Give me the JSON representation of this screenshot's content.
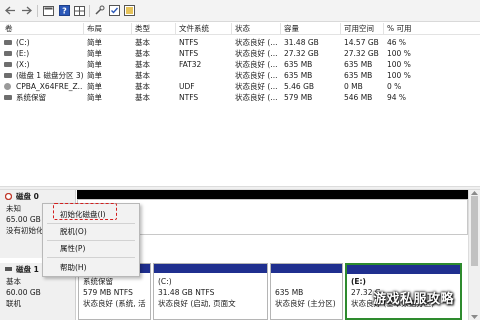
{
  "toolbar": {
    "icons": [
      "back-icon",
      "forward-icon",
      "view-icon",
      "help-icon",
      "grid-icon",
      "properties-icon",
      "checkmark-icon",
      "folder-icon"
    ]
  },
  "columns": [
    "卷",
    "布局",
    "类型",
    "文件系统",
    "状态",
    "容量",
    "可用空间",
    "% 可用"
  ],
  "volumes": [
    {
      "name": "(C:)",
      "layout": "简单",
      "type": "基本",
      "fs": "NTFS",
      "status": "状态良好 (...",
      "capacity": "31.48 GB",
      "free": "14.57 GB",
      "pct": "46 %",
      "icon": "disk"
    },
    {
      "name": "(E:)",
      "layout": "简单",
      "type": "基本",
      "fs": "NTFS",
      "status": "状态良好 (...",
      "capacity": "27.32 GB",
      "free": "27.32 GB",
      "pct": "100 %",
      "icon": "disk"
    },
    {
      "name": "(X:)",
      "layout": "简单",
      "type": "基本",
      "fs": "FAT32",
      "status": "状态良好 (...",
      "capacity": "635 MB",
      "free": "635 MB",
      "pct": "100 %",
      "icon": "disk"
    },
    {
      "name": "(磁盘 1 磁盘分区 3)",
      "layout": "简单",
      "type": "基本",
      "fs": "",
      "status": "状态良好 (...",
      "capacity": "635 MB",
      "free": "635 MB",
      "pct": "100 %",
      "icon": "disk"
    },
    {
      "name": "CPBA_X64FRE_Z...",
      "layout": "简单",
      "type": "基本",
      "fs": "UDF",
      "status": "状态良好 (...",
      "capacity": "5.46 GB",
      "free": "0 MB",
      "pct": "0 %",
      "icon": "cd"
    },
    {
      "name": "系统保留",
      "layout": "简单",
      "type": "基本",
      "fs": "NTFS",
      "status": "状态良好 (...",
      "capacity": "579 MB",
      "free": "546 MB",
      "pct": "94 %",
      "icon": "disk"
    }
  ],
  "disk0": {
    "label": "磁盘 0",
    "type": "未知",
    "size": "65.00 GB",
    "status": "没有初始化"
  },
  "disk1": {
    "label": "磁盘 1",
    "type": "基本",
    "size": "60.00 GB",
    "status": "联机"
  },
  "partitions": [
    {
      "name": "系统保留",
      "size": "579 MB NTFS",
      "status": "状态良好 (系统, 活"
    },
    {
      "name": "(C:)",
      "size": "31.48 GB NTFS",
      "status": "状态良好 (启动, 页面文"
    },
    {
      "name": "",
      "size": "635 MB",
      "status": "状态良好 (主分区)"
    },
    {
      "name": "(E:)",
      "size": "27.32 G",
      "status": "状态良好 (基本数据分区)"
    }
  ],
  "context_menu": {
    "items": [
      "初始化磁盘(I)",
      "脱机(O)",
      "属性(P)",
      "帮助(H)"
    ]
  },
  "watermark": "游戏私服攻略",
  "colors": {
    "partition_bar": "#1f2f8f",
    "highlight": "#d31f1f",
    "selected_border": "#2e8b2e"
  }
}
